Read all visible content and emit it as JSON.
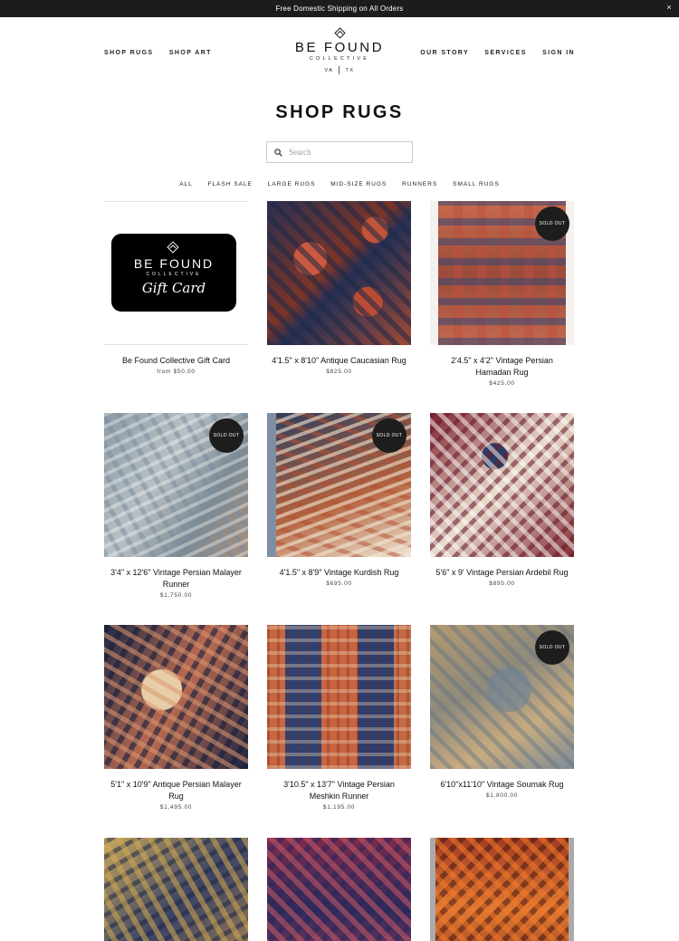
{
  "announcement": {
    "text": "Free Domestic Shipping on All Orders",
    "close_label": "×"
  },
  "nav": {
    "left": [
      "SHOP RUGS",
      "SHOP ART"
    ],
    "right": [
      "OUR STORY",
      "SERVICES",
      "SIGN IN"
    ]
  },
  "logo": {
    "name": "BE FOUND",
    "sub": "COLLECTIVE",
    "loc_left": "VA",
    "loc_right": "TX"
  },
  "page_title": "SHOP RUGS",
  "search": {
    "placeholder": "Search",
    "value": ""
  },
  "filters": [
    "ALL",
    "FLASH SALE",
    "LARGE RUGS",
    "MID-SIZE RUGS",
    "RUNNERS",
    "SMALL RUGS"
  ],
  "gift_card": {
    "line1": "BE FOUND",
    "line2": "COLLECTIVE",
    "line3": "Gift Card"
  },
  "sold_out_label": "SOLD OUT",
  "products": [
    {
      "name": "Be Found Collective Gift Card",
      "price": "from $50.00",
      "sold_out": false
    },
    {
      "name": "4'1.5\" x 8'10\" Antique Caucasian Rug",
      "price": "$825.00",
      "sold_out": false
    },
    {
      "name": "2'4.5\" x 4'2\" Vintage Persian Hamadan Rug",
      "price": "$425.00",
      "sold_out": true
    },
    {
      "name": "3'4\" x 12'6\" Vintage Persian Malayer Runner",
      "price": "$1,750.00",
      "sold_out": true
    },
    {
      "name": "4'1.5\" x 8'9\" Vintage Kurdish Rug",
      "price": "$695.00",
      "sold_out": true
    },
    {
      "name": "5'6\" x 9' Vintage Persian Ardebil Rug",
      "price": "$895.00",
      "sold_out": false
    },
    {
      "name": "5'1\" x 10'9\" Antique Persian Malayer Rug",
      "price": "$1,495.00",
      "sold_out": false
    },
    {
      "name": "3'10.5\" x 13'7\" Vintage Persian Meshkin Runner",
      "price": "$1,195.00",
      "sold_out": false
    },
    {
      "name": "6'10\"x11'10\" Vintage Soumak Rug",
      "price": "$1,800.00",
      "sold_out": true
    },
    {
      "name": "",
      "price": "",
      "sold_out": false
    },
    {
      "name": "",
      "price": "",
      "sold_out": false
    },
    {
      "name": "",
      "price": "",
      "sold_out": false
    }
  ]
}
